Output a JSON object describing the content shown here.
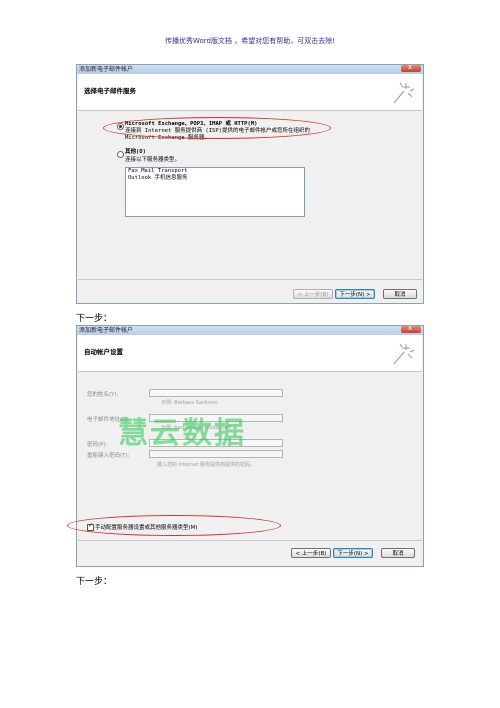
{
  "header": {
    "text": "传播优秀Word版文档 ，希望对您有帮助，可双击去除!"
  },
  "dialog1": {
    "title": "添加新电子邮件帐户",
    "section_title": "选择电子邮件服务",
    "option1_line1": "Microsoft Exchange、POP3、IMAP 或 HTTP(M)",
    "option1_line2": "连接到 Internet 服务提供商 (ISP)提供的电子邮件帐户或您所在组织的",
    "option1_line3": "Microsoft Exchange 服务器。",
    "option2_label": "其他(O)",
    "option2_desc": "连接以下服务器类型。",
    "server_types": [
      "Fax Mail Transport",
      "Outlook 手机信息服务"
    ],
    "buttons": {
      "back": "< 上一步(B)",
      "next": "下一步(N) >",
      "cancel": "取消"
    }
  },
  "caption1": "下一步：",
  "dialog2": {
    "title": "添加新电子邮件帐户",
    "section_title": "自动帐户设置",
    "name_label": "您的姓名(Y):",
    "name_hint": "示例: Barbara Sankovic",
    "email_label": "电子邮件地址(E):",
    "email_hint": "示例: barbara@contoso.com",
    "password_label": "密码(P):",
    "retype_label": "重新键入密码(T):",
    "password_hint": "键入您的 Internet 服务提供商提供的密码。",
    "manual_config_label": "手动配置服务器设置或其他服务器类型(M)",
    "buttons": {
      "back": "< 上一步(B)",
      "next": "下一步(N) >",
      "cancel": "取消"
    }
  },
  "caption2": "下一步：",
  "watermark": "慧云数据",
  "colors": {
    "highlight_ellipse": "#d0302e",
    "watermark": "#28c850",
    "header_text": "#2f2f9a"
  }
}
